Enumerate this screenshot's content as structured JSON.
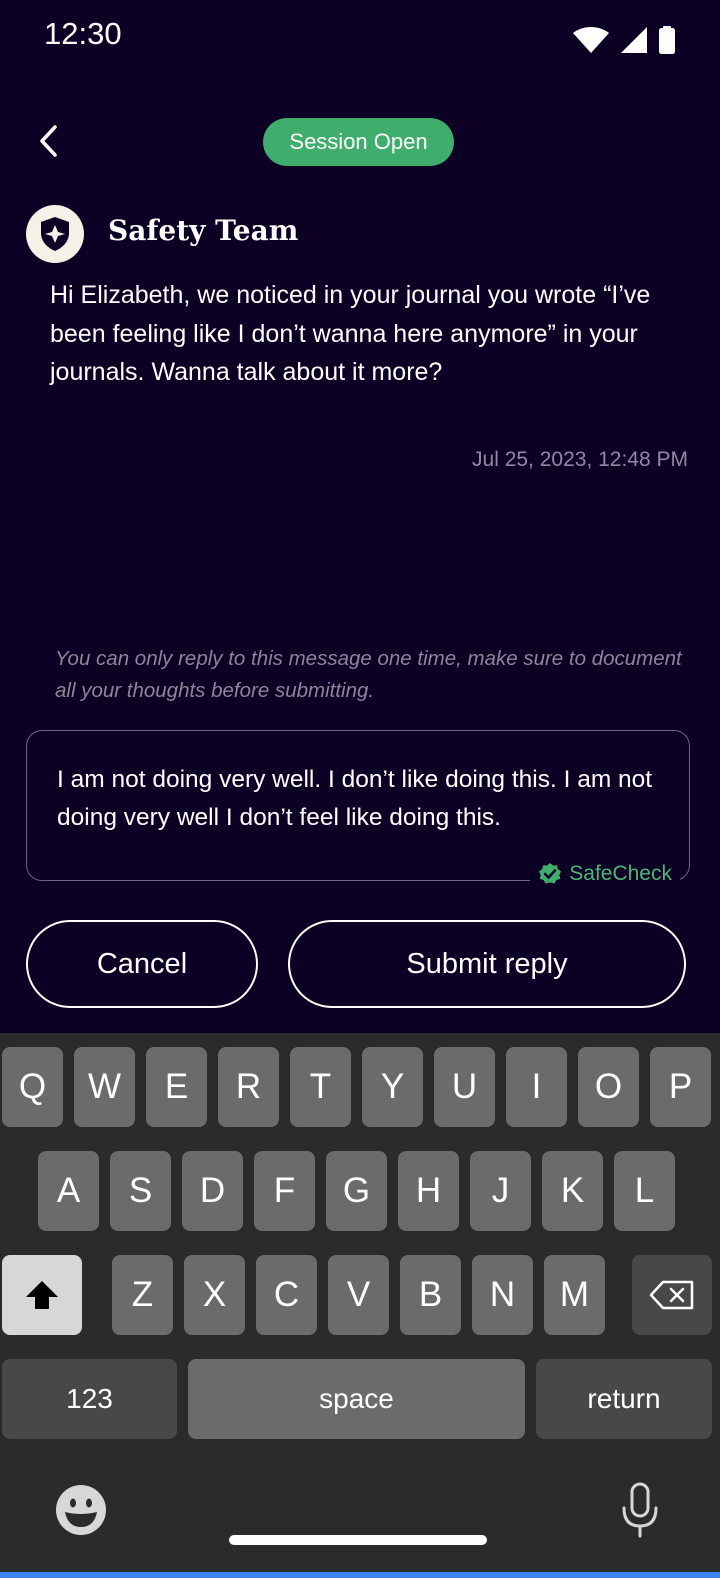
{
  "status_bar": {
    "time": "12:30"
  },
  "header": {
    "session_badge": "Session Open"
  },
  "message": {
    "sender": "Safety Team",
    "body": "Hi Elizabeth, we noticed in your journal you wrote “I’ve been feeling like I don’t wanna here anymore” in your journals. Wanna talk about it more?",
    "timestamp": "Jul 25, 2023, 12:48 PM"
  },
  "reply": {
    "note": "You can only reply to this message one time, make sure to document all your thoughts before submitting.",
    "text": "I am not doing very well. I don’t like doing this. I am not doing very well I don’t feel like doing this.",
    "safecheck_label": "SafeCheck",
    "cancel_label": "Cancel",
    "submit_label": "Submit reply"
  },
  "keyboard": {
    "row1": [
      "Q",
      "W",
      "E",
      "R",
      "T",
      "Y",
      "U",
      "I",
      "O",
      "P"
    ],
    "row2": [
      "A",
      "S",
      "D",
      "F",
      "G",
      "H",
      "J",
      "K",
      "L"
    ],
    "row3": [
      "Z",
      "X",
      "C",
      "V",
      "B",
      "N",
      "M"
    ],
    "numbers_label": "123",
    "space_label": "space",
    "return_label": "return"
  },
  "colors": {
    "background": "#0c0124",
    "accent_green": "#3fae6d",
    "keyboard_bg": "#2b2b2b",
    "key_bg": "#6b6b6b"
  },
  "icons": [
    "back-arrow-icon",
    "wifi-icon",
    "signal-icon",
    "battery-icon",
    "shield-icon",
    "check-badge-icon",
    "shift-icon",
    "backspace-icon",
    "emoji-icon",
    "microphone-icon"
  ]
}
